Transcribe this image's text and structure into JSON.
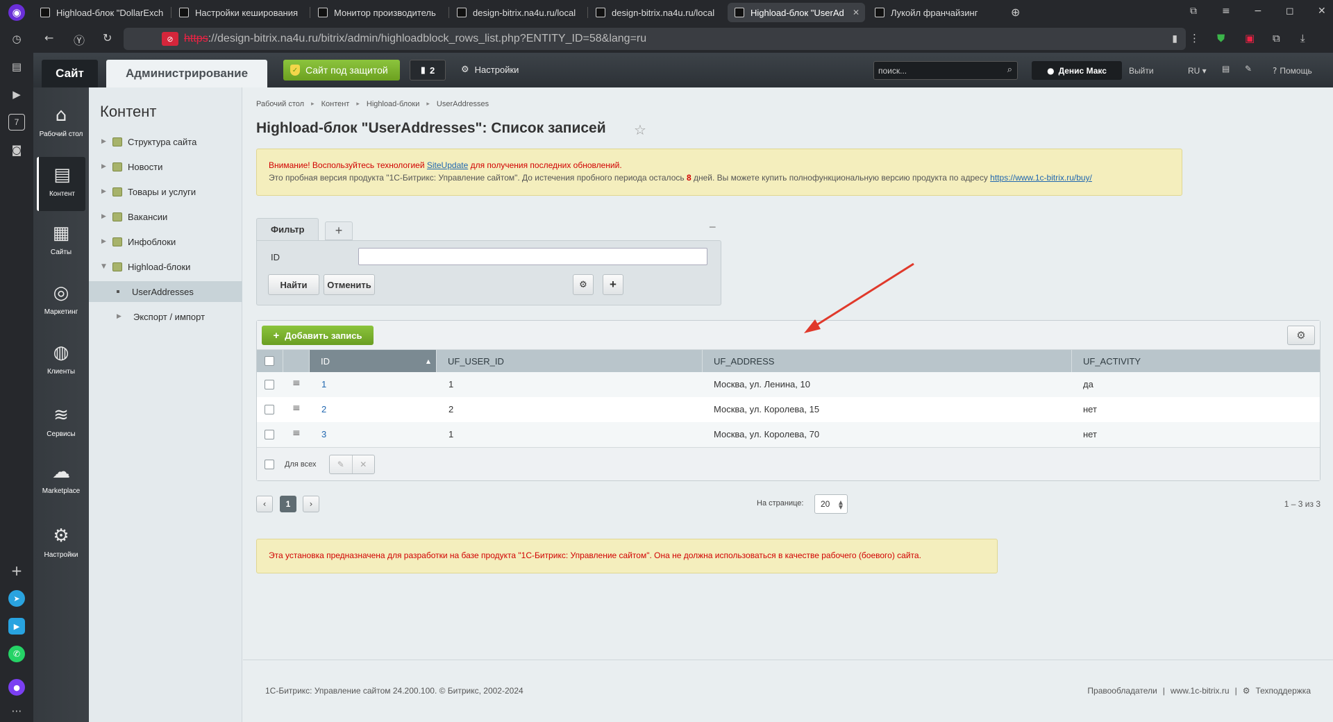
{
  "browser": {
    "tabs": [
      {
        "title": "Highload-блок \"DollarExch"
      },
      {
        "title": "Настройки кеширования"
      },
      {
        "title": "Монитор производитель"
      },
      {
        "title": "design-bitrix.na4u.ru/local"
      },
      {
        "title": "design-bitrix.na4u.ru/local"
      },
      {
        "title": "Highload-блок \"UserAd"
      },
      {
        "title": "Лукойл франчайзинг"
      }
    ],
    "url_proto": "https",
    "url_rest": "://design-bitrix.na4u.ru/bitrix/admin/highloadblock_rows_list.php?ENTITY_ID=58&lang=ru",
    "sidebar_badge": "7"
  },
  "topbar": {
    "site": "Сайт",
    "admin": "Администрирование",
    "secure": "Сайт под защитой",
    "notif_count": "2",
    "settings": "Настройки",
    "search_placeholder": "поиск...",
    "user": "Денис Макс",
    "logout": "Выйти",
    "lang": "RU",
    "help": "Помощь"
  },
  "left_menu": [
    {
      "label": "Рабочий стол",
      "icon": "home-icon"
    },
    {
      "label": "Контент",
      "icon": "document-icon"
    },
    {
      "label": "Сайты",
      "icon": "calendar-icon"
    },
    {
      "label": "Маркетинг",
      "icon": "target-icon"
    },
    {
      "label": "Клиенты",
      "icon": "clients-icon"
    },
    {
      "label": "Сервисы",
      "icon": "layers-icon"
    },
    {
      "label": "Marketplace",
      "icon": "cloud-download-icon"
    },
    {
      "label": "Настройки",
      "icon": "gear-icon"
    }
  ],
  "content_menu": {
    "title": "Контент",
    "items": [
      {
        "label": "Структура сайта"
      },
      {
        "label": "Новости"
      },
      {
        "label": "Товары и услуги"
      },
      {
        "label": "Вакансии"
      },
      {
        "label": "Инфоблоки"
      },
      {
        "label": "Highload-блоки"
      },
      {
        "label": "UserAddresses"
      },
      {
        "label": "Экспорт / импорт"
      }
    ]
  },
  "breadcrumbs": [
    "Рабочий стол",
    "Контент",
    "Highload-блоки",
    "UserAddresses"
  ],
  "page_title": "Highload-блок \"UserAddresses\": Список записей",
  "notice": {
    "p1": "Внимание! Воспользуйтесь технологией ",
    "link1": "SiteUpdate",
    "p2": " для получения последних обновлений.",
    "p3": "Это пробная версия продукта \"1С-Битрикс: Управление сайтом\". До истечения пробного периода осталось ",
    "days": "8",
    "p4": " дней. Вы можете купить полнофункциональную версию продукта по адресу ",
    "link2": "https://www.1c-bitrix.ru/buy/"
  },
  "filter": {
    "tab": "Фильтр",
    "field_label": "ID",
    "field_value": "",
    "find": "Найти",
    "cancel": "Отменить"
  },
  "grid": {
    "add": "Добавить запись",
    "columns": [
      "ID",
      "UF_USER_ID",
      "UF_ADDRESS",
      "UF_ACTIVITY"
    ],
    "rows": [
      {
        "id": "1",
        "user_id": "1",
        "address": "Москва, ул. Ленина, 10",
        "activity": "да"
      },
      {
        "id": "2",
        "user_id": "2",
        "address": "Москва, ул. Королева, 15",
        "activity": "нет"
      },
      {
        "id": "3",
        "user_id": "1",
        "address": "Москва, ул. Королева, 70",
        "activity": "нет"
      }
    ],
    "for_all": "Для всех"
  },
  "pager": {
    "current": "1",
    "per_page_label": "На странице:",
    "per_page": "20",
    "count": "1 – 3 из 3"
  },
  "warning": "Эта установка предназначена для разработки на базе продукта \"1С-Битрикс: Управление сайтом\". Она не должна использоваться в качестве рабочего (боевого) сайта.",
  "footer": {
    "copyright": "1С-Битрикс: Управление сайтом 24.200.100. © Битрикс, 2002-2024",
    "rights": "Правообладатели",
    "site": "www.1c-bitrix.ru",
    "support": "Техподдержка"
  },
  "colors": {
    "accent_green": "#7ab32e",
    "arrow": "#e0392b",
    "warning_red": "#d10000"
  }
}
